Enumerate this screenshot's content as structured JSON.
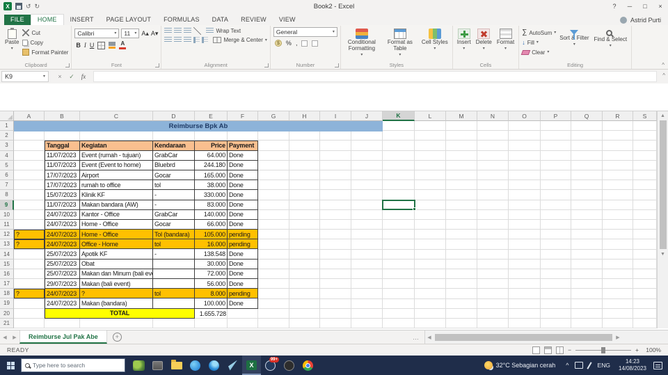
{
  "glyphs": {
    "excel_x": "X",
    "dropdown": "▾",
    "undo": "↺",
    "redo": "↻",
    "minimize": "─",
    "maximize": "□",
    "close": "×",
    "help": "?",
    "cancel": "×",
    "check": "✓",
    "fx": "fx",
    "sigma": "∑",
    "fill_arrow": "↓",
    "bold": "B",
    "italic": "I",
    "underline": "U",
    "font_a": "A",
    "grow": "A▴",
    "shrink": "A▾",
    "dollar": "$",
    "percent": "%",
    "comma": ",",
    "left": "◀",
    "right": "▶",
    "up": "▲",
    "down": "▼",
    "plus": "+",
    "minus": "−",
    "ellipsis": "…",
    "chevron_up": "^"
  },
  "window": {
    "title": "Book2 - Excel",
    "user": "Astrid Purti"
  },
  "ribbon": {
    "tabs": [
      "FILE",
      "HOME",
      "INSERT",
      "PAGE LAYOUT",
      "FORMULAS",
      "DATA",
      "REVIEW",
      "VIEW"
    ],
    "active_tab": "HOME",
    "clipboard": {
      "label": "Clipboard",
      "paste": "Paste",
      "cut": "Cut",
      "copy": "Copy",
      "format_painter": "Format Painter"
    },
    "font": {
      "label": "Font",
      "family": "Calibri",
      "size": "11"
    },
    "alignment": {
      "label": "Alignment",
      "wrap_text": "Wrap Text",
      "merge_center": "Merge & Center"
    },
    "number": {
      "label": "Number",
      "format": "General"
    },
    "styles": {
      "label": "Styles",
      "conditional_formatting": "Conditional Formatting",
      "format_as_table": "Format as Table",
      "cell_styles": "Cell Styles"
    },
    "cells": {
      "label": "Cells",
      "insert": "Insert",
      "delete": "Delete",
      "format": "Format"
    },
    "editing": {
      "label": "Editing",
      "autosum": "AutoSum",
      "fill": "Fill",
      "clear": "Clear",
      "sort_filter": "Sort & Filter",
      "find_select": "Find & Select"
    }
  },
  "formula_bar": {
    "name_box": "K9",
    "formula": ""
  },
  "grid": {
    "columns": [
      "A",
      "B",
      "C",
      "D",
      "E",
      "F",
      "G",
      "H",
      "I",
      "J",
      "K",
      "L",
      "M",
      "N",
      "O",
      "P",
      "Q",
      "R",
      "S"
    ],
    "row_count": 21,
    "selected": {
      "cell": "K9",
      "col": "K",
      "row": 9
    }
  },
  "sheet": {
    "title": "Reimburse Bpk Ab",
    "headers": [
      "Tanggal",
      "Kegiatan",
      "Kendaraan",
      "Price",
      "Payment"
    ],
    "rows": [
      {
        "flag": "",
        "date": "11/07/2023",
        "activity": "Event (rumah - tujuan)",
        "vehicle": "GrabCar",
        "price": "64.000",
        "payment": "Done",
        "highlight": false
      },
      {
        "flag": "",
        "date": "11/07/2023",
        "activity": "Event (Event to home)",
        "vehicle": "Bluebrd",
        "price": "244.180",
        "payment": "Done",
        "highlight": false
      },
      {
        "flag": "",
        "date": "17/07/2023",
        "activity": "Airport",
        "vehicle": "Gocar",
        "price": "165.000",
        "payment": "Done",
        "highlight": false
      },
      {
        "flag": "",
        "date": "17/07/2023",
        "activity": "rumah to office",
        "vehicle": "tol",
        "price": "38.000",
        "payment": "Done",
        "highlight": false
      },
      {
        "flag": "",
        "date": "15/07/2023",
        "activity": "Klinik KF",
        "vehicle": "-",
        "price": "330.000",
        "payment": "Done",
        "highlight": false
      },
      {
        "flag": "",
        "date": "11/07/2023",
        "activity": "Makan bandara (AW)",
        "vehicle": "-",
        "price": "83.000",
        "payment": "Done",
        "highlight": false
      },
      {
        "flag": "",
        "date": "24/07/2023",
        "activity": "Kantor - Office",
        "vehicle": "GrabCar",
        "price": "140.000",
        "payment": "Done",
        "highlight": false
      },
      {
        "flag": "",
        "date": "24/07/2023",
        "activity": "Home - Office",
        "vehicle": "Gocar",
        "price": "66.000",
        "payment": "Done",
        "highlight": false
      },
      {
        "flag": "?",
        "date": "24/07/2023",
        "activity": "Home - Office",
        "vehicle": "Tol (bandara)",
        "price": "105.000",
        "payment": "pending",
        "highlight": true
      },
      {
        "flag": "?",
        "date": "24/07/2023",
        "activity": "Office - Home",
        "vehicle": "tol",
        "price": "16.000",
        "payment": "pending",
        "highlight": true
      },
      {
        "flag": "",
        "date": "25/07/2023",
        "activity": "Apotik KF",
        "vehicle": "-",
        "price": "138.548",
        "payment": "Done",
        "highlight": false
      },
      {
        "flag": "",
        "date": "25/07/2023",
        "activity": "Obat",
        "vehicle": "",
        "price": "30.000",
        "payment": "Done",
        "highlight": false
      },
      {
        "flag": "",
        "date": "25/07/2023",
        "activity": "Makan dan Minum (bali event)",
        "vehicle": "",
        "price": "72.000",
        "payment": "Done",
        "highlight": false
      },
      {
        "flag": "",
        "date": "29/07/2023",
        "activity": "Makan (bali event)",
        "vehicle": "",
        "price": "56.000",
        "payment": "Done",
        "highlight": false
      },
      {
        "flag": "?",
        "date": "24/07/2023",
        "activity": "?",
        "vehicle": "tol",
        "price": "8.000",
        "payment": "pending",
        "highlight": true
      },
      {
        "flag": "",
        "date": "24/07/2023",
        "activity": "Makan (bandara)",
        "vehicle": "",
        "price": "100.000",
        "payment": "Done",
        "highlight": false
      }
    ],
    "total_label": "TOTAL",
    "total_value": "1.655.728"
  },
  "sheet_tabs": {
    "active": "Reimburse Jul Pak Abe"
  },
  "status": {
    "mode": "READY",
    "zoom": "100%"
  },
  "taskbar": {
    "search_placeholder": "Type here to search",
    "chat_badge": "99+",
    "weather": "32°C  Sebagian cerah",
    "language": "ENG",
    "time": "14:23",
    "date": "14/08/2023"
  }
}
